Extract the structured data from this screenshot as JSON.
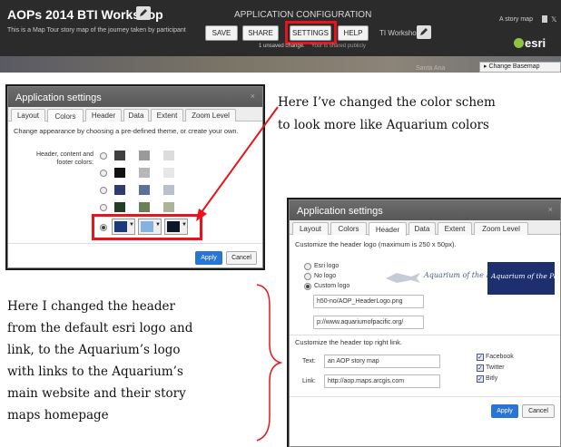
{
  "builder": {
    "app_title": "AOPs 2014 BTI Workshop",
    "subtitle": "This is a Map Tour story map of the journey taken by participant",
    "config_title": "APPLICATION CONFIGURATION",
    "buttons": [
      "SAVE",
      "SHARE",
      "SETTINGS",
      "HELP"
    ],
    "unsaved": "1 unsaved change.",
    "shared": "Your is shared publicly",
    "ti_workshop": "TI Workshop",
    "story_link": "A story map",
    "esri": "esri",
    "change_basemap": "▸ Change Basemap",
    "map_label": "Santa Ana"
  },
  "dialog1": {
    "title": "Application settings",
    "close": "×",
    "tabs": [
      "Layout",
      "Colors",
      "Header",
      "Data",
      "Extent",
      "Zoom Level"
    ],
    "active_tab": "Colors",
    "description": "Change appearance by choosing a pre-defined theme, or create your own.",
    "label": "Header, content and footer colors:",
    "themes": [
      [
        "#404040",
        "#9a9a9a",
        "#dcdcdc"
      ],
      [
        "#111111",
        "#b7b7b7",
        "#e7e7e7"
      ],
      [
        "#2e3c6e",
        "#5b6f9a",
        "#b9bfcc"
      ],
      [
        "#253d26",
        "#6a7f57",
        "#a9b49b"
      ]
    ],
    "custom_theme": [
      "#1d3a78",
      "#85b3de",
      "#0e1726"
    ],
    "apply": "Apply",
    "cancel": "Cancel"
  },
  "dialog2": {
    "title": "Application settings",
    "close": "×",
    "tabs": [
      "Layout",
      "Colors",
      "Header",
      "Data",
      "Extent",
      "Zoom Level"
    ],
    "active_tab": "Header",
    "logo_caption": "Customize the header logo (maximum is 250 x 50px).",
    "logo_options": [
      "Esri logo",
      "No logo",
      "Custom logo"
    ],
    "selected_logo": "Custom logo",
    "logo_url": "h50-no/AOP_HeaderLogo.png",
    "logo_link": "p://www.aquariumofpacific.org/",
    "aquarium_logo": "Aquarium of the Pacific",
    "link_caption": "Customize the header top right link.",
    "text_label": "Text:",
    "text_value": "an AOP story map",
    "link_label": "Link:",
    "link_value": "http://aop.maps.arcgis.com",
    "social": [
      "Facebook",
      "Twitter",
      "Bitly"
    ],
    "apply": "Apply",
    "cancel": "Cancel"
  },
  "annotations": {
    "top_right": [
      "Here I’ve changed the color schem",
      "to look more like Aquarium colors"
    ],
    "left": [
      "Here I changed the header",
      "from the default esri logo and",
      "link, to the Aquarium’s logo",
      "with links to the Aquarium’s",
      "main website and their story",
      "maps homepage"
    ]
  },
  "colors": {
    "highlight": "#e8141b",
    "apply_blue": "#2a74d6",
    "dialog_header": "#606060"
  }
}
